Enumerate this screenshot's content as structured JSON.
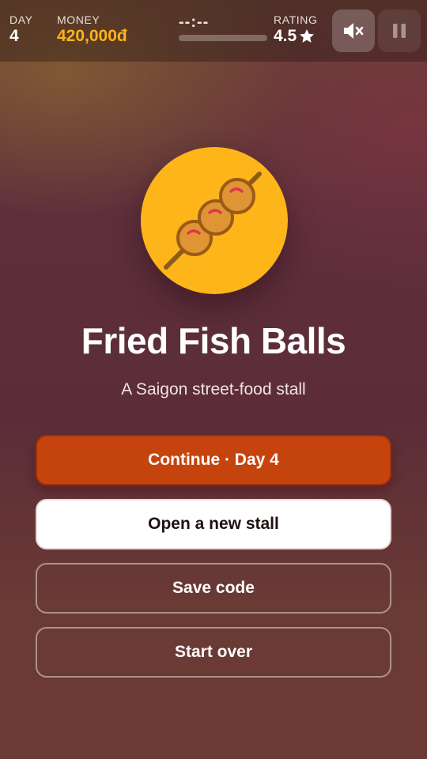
{
  "hud": {
    "day_label": "DAY",
    "day_value": "4",
    "money_label": "MONEY",
    "money_value": "420,000đ",
    "timer_text": "--:--",
    "timer_progress": 0,
    "rating_label": "RATING",
    "rating_value": "4.5",
    "rating_icon": "star-icon",
    "mute_icon": "speaker-muted-icon",
    "pause_icon": "pause-icon"
  },
  "hero": {
    "icon": "fish-ball-skewer-icon",
    "circle_color": "#fdb51a"
  },
  "title": "Fried Fish Balls",
  "subtitle": "A Saigon street-food stall",
  "buttons": {
    "continue": "Continue · Day 4",
    "new_stall": "Open a new stall",
    "save_code": "Save code",
    "start_over": "Start over"
  },
  "colors": {
    "accent": "#c5440d",
    "money": "#ffb21a"
  }
}
